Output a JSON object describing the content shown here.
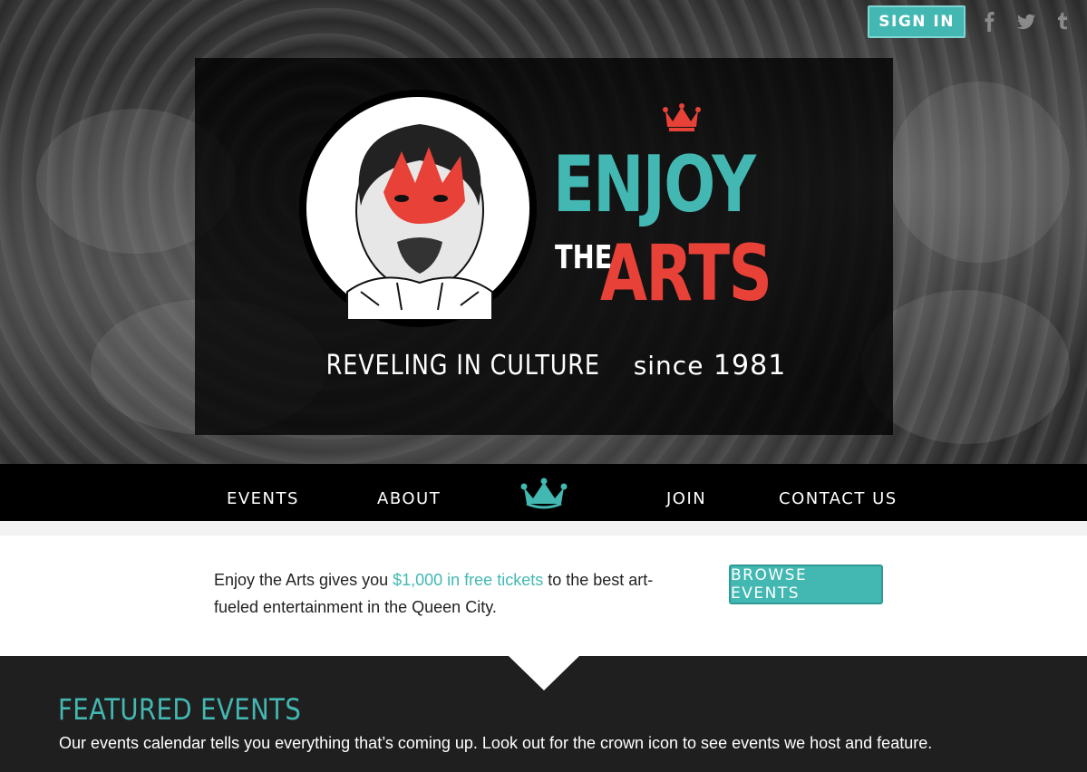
{
  "header": {
    "signin_label": "SIGN IN",
    "social": [
      {
        "icon": "facebook-icon"
      },
      {
        "icon": "twitter-icon"
      },
      {
        "icon": "tumblr-icon"
      }
    ]
  },
  "hero": {
    "logo": {
      "word1": "ENJOY",
      "word2": "THE",
      "word3": "ARTS"
    },
    "tagline": {
      "part1": "REVELING IN CULTURE",
      "part2": "since",
      "part3": "1981"
    }
  },
  "nav": {
    "items": [
      "EVENTS",
      "ABOUT",
      "JOIN",
      "CONTACT US"
    ],
    "home_icon": "crown-icon"
  },
  "intro": {
    "text_before": "Enjoy the Arts gives you ",
    "highlight": "$1,000 in free tickets",
    "text_after": " to the best art-fueled entertainment in the Queen City.",
    "button_label": "BROWSE EVENTS"
  },
  "featured": {
    "title": "FEATURED EVENTS",
    "description": "Our events calendar tells you everything that’s coming up. Look out for the crown icon to see events we host and feature."
  },
  "colors": {
    "accent_teal": "#43b8b2",
    "accent_red": "#e84138",
    "dark": "#1f1f1f"
  }
}
